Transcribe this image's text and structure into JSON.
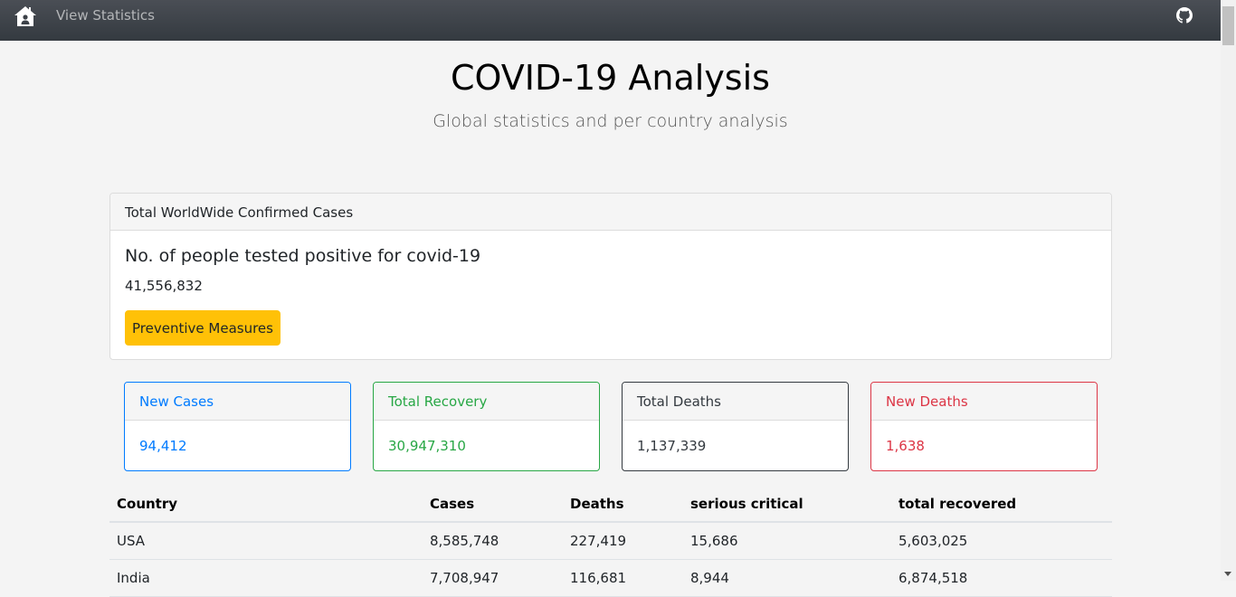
{
  "navbar": {
    "home_icon": "home-icon",
    "link_label": "View Statistics",
    "github_icon": "github-icon"
  },
  "hero": {
    "title": "COVID-19 Analysis",
    "subtitle": "Global statistics and per country analysis"
  },
  "summary_card": {
    "header": "Total WorldWide Confirmed Cases",
    "title": "No. of people tested positive for covid-19",
    "value": "41,556,832",
    "button_label": "Preventive Measures"
  },
  "stats": [
    {
      "label": "New Cases",
      "value": "94,412",
      "color": "#007bff"
    },
    {
      "label": "Total Recovery",
      "value": "30,947,310",
      "color": "#28a745"
    },
    {
      "label": "Total Deaths",
      "value": "1,137,339",
      "color": "#343a40"
    },
    {
      "label": "New Deaths",
      "value": "1,638",
      "color": "#dc3545"
    }
  ],
  "table": {
    "headers": [
      "Country",
      "Cases",
      "Deaths",
      "serious critical",
      "total recovered"
    ],
    "rows": [
      [
        "USA",
        "8,585,748",
        "227,419",
        "15,686",
        "5,603,025"
      ],
      [
        "India",
        "7,708,947",
        "116,681",
        "8,944",
        "6,874,518"
      ]
    ]
  }
}
